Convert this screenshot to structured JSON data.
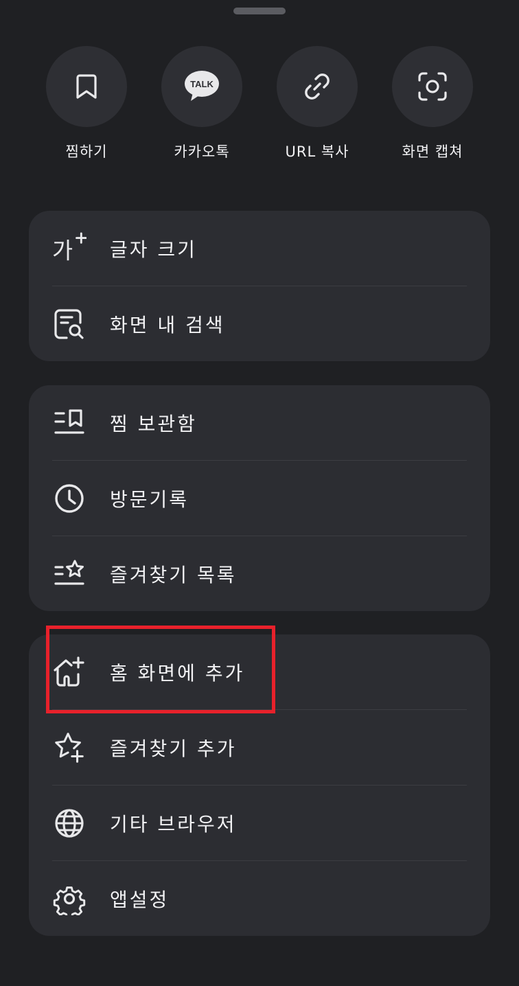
{
  "quick_actions": [
    {
      "label": "찜하기",
      "icon": "bookmark-icon"
    },
    {
      "label": "카카오톡",
      "icon": "kakaotalk-icon",
      "icon_text": "TALK"
    },
    {
      "label": "URL 복사",
      "icon": "link-icon"
    },
    {
      "label": "화면 캡쳐",
      "icon": "screen-capture-icon"
    }
  ],
  "group1": [
    {
      "label": "글자 크기",
      "icon": "font-size-icon",
      "icon_text": "가"
    },
    {
      "label": "화면 내 검색",
      "icon": "find-in-page-icon"
    }
  ],
  "group2": [
    {
      "label": "찜 보관함",
      "icon": "bookmark-list-icon"
    },
    {
      "label": "방문기록",
      "icon": "history-clock-icon"
    },
    {
      "label": "즐겨찾기 목록",
      "icon": "favorites-list-icon"
    }
  ],
  "group3": [
    {
      "label": "홈 화면에 추가",
      "icon": "add-to-home-icon"
    },
    {
      "label": "즐겨찾기 추가",
      "icon": "add-favorite-star-icon"
    },
    {
      "label": "기타 브라우저",
      "icon": "globe-icon"
    },
    {
      "label": "앱설정",
      "icon": "settings-gear-icon"
    }
  ],
  "colors": {
    "background": "#1f2023",
    "card": "#2c2d32",
    "highlight": "#e8212b"
  }
}
